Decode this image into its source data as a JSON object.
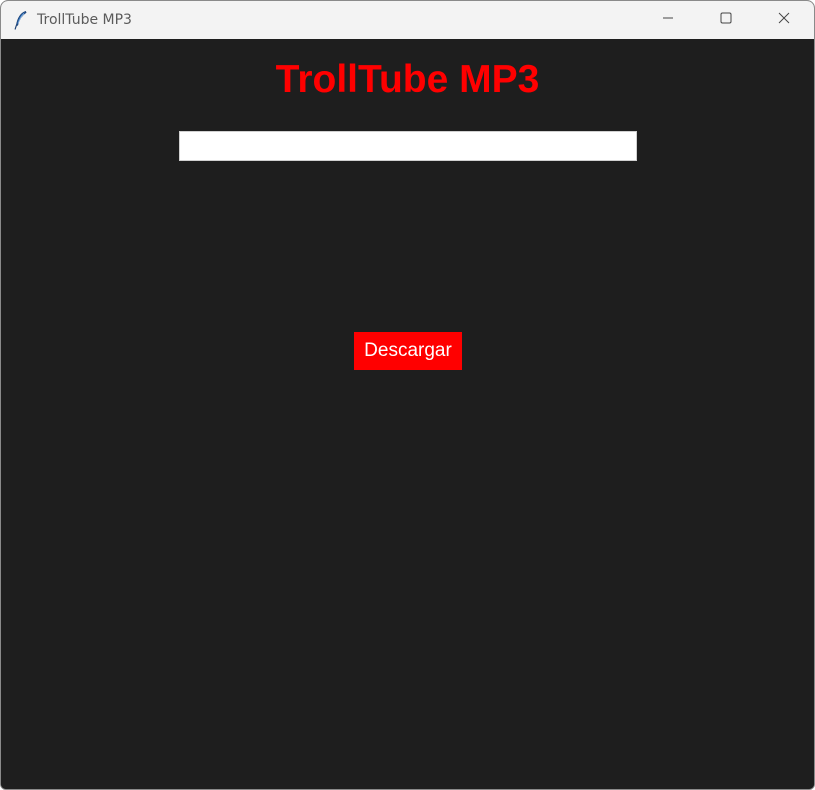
{
  "window": {
    "title": "TrollTube MP3"
  },
  "icons": {
    "app": "feather-icon",
    "minimize": "minimize-icon",
    "maximize": "maximize-icon",
    "close": "close-icon"
  },
  "app": {
    "heading": "TrollTube MP3",
    "url_input": {
      "value": "",
      "placeholder": ""
    },
    "download_button_label": "Descargar"
  },
  "colors": {
    "background": "#1e1e1e",
    "accent": "#ff0000",
    "titlebar": "#f3f3f3",
    "button_text": "#ffffff"
  }
}
